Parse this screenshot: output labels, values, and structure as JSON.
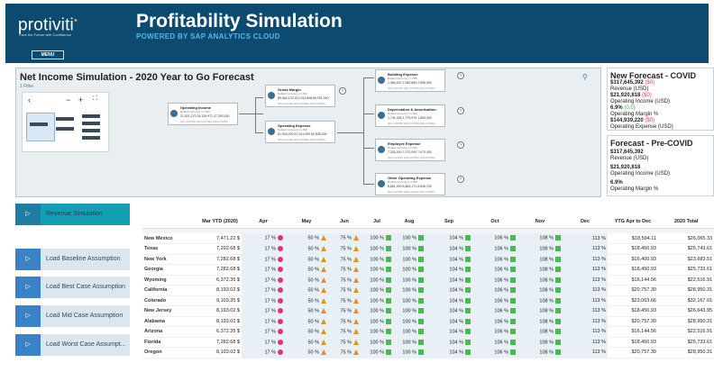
{
  "header": {
    "logo": "protiviti",
    "tagline": "Face the Future with Confidence",
    "menu_label": "MENU",
    "title": "Profitability Simulation",
    "subtitle": "POWERED BY SAP ANALYTICS CLOUD"
  },
  "simulation": {
    "title": "Net Income Simulation - 2020 Year to Go Forecast",
    "filter": "1 Filter",
    "nodes": [
      {
        "title": "Operating Income",
        "sub": "Default Currency in USD",
        "vals": "21,921,270  24,129,971  27,252,520",
        "lbls": "(DO-COVID)   (DO-COVID)   (DO-COVID)"
      },
      {
        "title": "Gross Margin",
        "sub": "Default Currency in USD",
        "vals": "89,064,123  101,091,898  89,091,000",
        "lbls": "(DO-COVID)   (DO-COVID)   (DO-COVID)"
      },
      {
        "title": "Operating Expense",
        "sub": "Default Currency in USD",
        "vals": "61,530,000  67,041,900  62,835,000",
        "lbls": "(DO-COVID)   (DO-COVID)   (DO-COVID)"
      },
      {
        "title": "Building Expense",
        "sub": "Default Currency in USD",
        "vals": "1,984,037  2,082,869  2,895,000",
        "lbls": "(DO-COVID)   (DO-COVID)   (DO-COVID)"
      },
      {
        "title": "Depreciation & Amortization",
        "sub": "Default Currency in USD",
        "vals": "1,741,035  1,779,979  1,893,000",
        "lbls": "(DO-COVID)   (DO-COVID)   (DO-COVID)"
      },
      {
        "title": "Employee Expense",
        "sub": "Default Currency in USD",
        "vals": "7,033,000  7,070,000  7,073,000",
        "lbls": "(DO-COVID)   (DO-COVID)   (DO-COVID)"
      },
      {
        "title": "Other Operating Expense",
        "sub": "Default Currency in USD",
        "vals": "8,661,000  8,863,171  8,845,700",
        "lbls": "(DO-COVID)   (DO-COVID)   (DO-COVID)"
      }
    ]
  },
  "kpi_new": {
    "title": "New Forecast - COVID",
    "revenue": "$317,645,392",
    "revenue_delta": "($0)",
    "revenue_label": "Revenue (USD)",
    "op_income": "$21,920,818",
    "op_income_delta": "($0)",
    "op_income_label": "Operating Income (USD)",
    "margin": "6.9%",
    "margin_delta": "(0.0)",
    "margin_label": "Operating Margin %",
    "op_exp": "$144,939,220",
    "op_exp_delta": "($0)",
    "op_exp_label": "Operating Expense (USD)"
  },
  "kpi_pre": {
    "title": "Forecast - Pre-COVID",
    "revenue": "$317,645,392",
    "revenue_label": "Revenue (USD)",
    "op_income": "$21,920,818",
    "op_income_label": "Operating Income (USD)",
    "margin": "6.9%",
    "margin_label": "Operating Margin %"
  },
  "buttons": [
    {
      "label": "Revenue Simulation"
    },
    {
      "label": "Load Baseline Assumption"
    },
    {
      "label": "Load Best Case Assumption"
    },
    {
      "label": "Load Mid Case Assumption"
    },
    {
      "label": "Load Worst Case Assumpt..."
    }
  ],
  "table": {
    "columns": [
      "",
      "Mar YTD (2020)",
      "Apr",
      "May",
      "Jun",
      "Jul",
      "Aug",
      "Sep",
      "Oct",
      "Nov",
      "Dec",
      "YTG Apr to Dec",
      "2020 Total"
    ],
    "rows": [
      {
        "state": "New Mexico",
        "ytd": "7,471.22 $",
        "apr": "17 %",
        "may": "50 %",
        "jun": "75 %",
        "jul": "100 %",
        "aug": "100 %",
        "sep": "104 %",
        "oct": "106 %",
        "nov": "108 %",
        "dec": "113 %",
        "ytg": "$18,594.11",
        "total": "$26,065.33"
      },
      {
        "state": "Texas",
        "ytd": "7,292.68 $",
        "apr": "17 %",
        "may": "50 %",
        "jun": "75 %",
        "jul": "100 %",
        "aug": "100 %",
        "sep": "104 %",
        "oct": "106 %",
        "nov": "108 %",
        "dec": "113 %",
        "ytg": "$18,450.93",
        "total": "$25,743.61"
      },
      {
        "state": "New York",
        "ytd": "7,282.68 $",
        "apr": "17 %",
        "may": "50 %",
        "jun": "75 %",
        "jul": "100 %",
        "aug": "100 %",
        "sep": "104 %",
        "oct": "106 %",
        "nov": "108 %",
        "dec": "113 %",
        "ytg": "$16,400.93",
        "total": "$23,683.51"
      },
      {
        "state": "Georgia",
        "ytd": "7,282.68 $",
        "apr": "17 %",
        "may": "50 %",
        "jun": "75 %",
        "jul": "100 %",
        "aug": "100 %",
        "sep": "104 %",
        "oct": "106 %",
        "nov": "108 %",
        "dec": "113 %",
        "ytg": "$18,450.93",
        "total": "$25,733.61"
      },
      {
        "state": "Wyoming",
        "ytd": "6,372.35 $",
        "apr": "17 %",
        "may": "50 %",
        "jun": "75 %",
        "jul": "100 %",
        "aug": "100 %",
        "sep": "104 %",
        "oct": "106 %",
        "nov": "108 %",
        "dec": "113 %",
        "ytg": "$16,144.56",
        "total": "$22,516.91"
      },
      {
        "state": "California",
        "ytd": "8,193.02 $",
        "apr": "17 %",
        "may": "50 %",
        "jun": "75 %",
        "jul": "100 %",
        "aug": "100 %",
        "sep": "104 %",
        "oct": "106 %",
        "nov": "108 %",
        "dec": "113 %",
        "ytg": "$20,757.30",
        "total": "$28,950.31"
      },
      {
        "state": "Colorado",
        "ytd": "9,103.35 $",
        "apr": "17 %",
        "may": "50 %",
        "jun": "75 %",
        "jul": "100 %",
        "aug": "100 %",
        "sep": "104 %",
        "oct": "106 %",
        "nov": "108 %",
        "dec": "113 %",
        "ytg": "$23,063.66",
        "total": "$32,167.01"
      },
      {
        "state": "New Jersey",
        "ytd": "8,193.02 $",
        "apr": "17 %",
        "may": "50 %",
        "jun": "75 %",
        "jul": "100 %",
        "aug": "100 %",
        "sep": "104 %",
        "oct": "106 %",
        "nov": "108 %",
        "dec": "113 %",
        "ytg": "$18,450.93",
        "total": "$26,643.95"
      },
      {
        "state": "Alabama",
        "ytd": "8,193.02 $",
        "apr": "17 %",
        "may": "50 %",
        "jun": "75 %",
        "jul": "100 %",
        "aug": "100 %",
        "sep": "104 %",
        "oct": "106 %",
        "nov": "108 %",
        "dec": "113 %",
        "ytg": "$20,757.30",
        "total": "$28,950.31"
      },
      {
        "state": "Arizona",
        "ytd": "6,372.35 $",
        "apr": "17 %",
        "may": "50 %",
        "jun": "75 %",
        "jul": "100 %",
        "aug": "100 %",
        "sep": "104 %",
        "oct": "106 %",
        "nov": "108 %",
        "dec": "113 %",
        "ytg": "$16,144.56",
        "total": "$22,516.91"
      },
      {
        "state": "Florida",
        "ytd": "7,282.68 $",
        "apr": "17 %",
        "may": "50 %",
        "jun": "75 %",
        "jul": "100 %",
        "aug": "100 %",
        "sep": "104 %",
        "oct": "106 %",
        "nov": "108 %",
        "dec": "113 %",
        "ytg": "$18,450.93",
        "total": "$25,733.61"
      },
      {
        "state": "Oregon",
        "ytd": "8,193.02 $",
        "apr": "17 %",
        "may": "50 %",
        "jun": "75 %",
        "jul": "100 %",
        "aug": "100 %",
        "sep": "104 %",
        "oct": "106 %",
        "nov": "108 %",
        "dec": "113 %",
        "ytg": "$20,757.30",
        "total": "$28,950.31"
      }
    ]
  },
  "colors": {
    "brand": "#0d4a70",
    "accent": "#55b6ea",
    "active_button": "#13a0b3",
    "status_red": "#e0356f",
    "status_orange": "#e8901c",
    "status_green": "#4cb853"
  },
  "icons": {
    "play": "play-icon",
    "search": "search-icon",
    "expand": "chevron-right-icon"
  }
}
